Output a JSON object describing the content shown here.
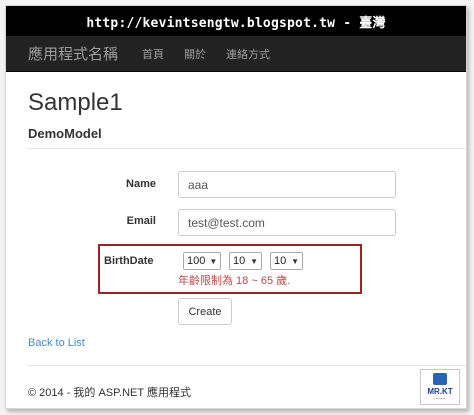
{
  "banner": {
    "url_text": "http://kevintsengtw.blogspot.tw - 臺灣"
  },
  "navbar": {
    "brand": "應用程式名稱",
    "links": [
      "首頁",
      "關於",
      "連絡方式"
    ]
  },
  "page": {
    "title": "Sample1",
    "subtitle": "DemoModel"
  },
  "form": {
    "name": {
      "label": "Name",
      "value": "aaa"
    },
    "email": {
      "label": "Email",
      "value": "test@test.com"
    },
    "birthdate": {
      "label": "BirthDate",
      "year": "100",
      "month": "10",
      "day": "10",
      "validation": "年齡限制為 18 ~ 65 歲."
    },
    "submit_label": "Create"
  },
  "back_link": "Back to List",
  "footer": "© 2014 - 我的 ASP.NET 應用程式",
  "logo": {
    "text": "MR.KT"
  },
  "colors": {
    "navbar": "#222222",
    "highlight": "#a02226",
    "link": "#428bca",
    "error": "#b94a48"
  }
}
